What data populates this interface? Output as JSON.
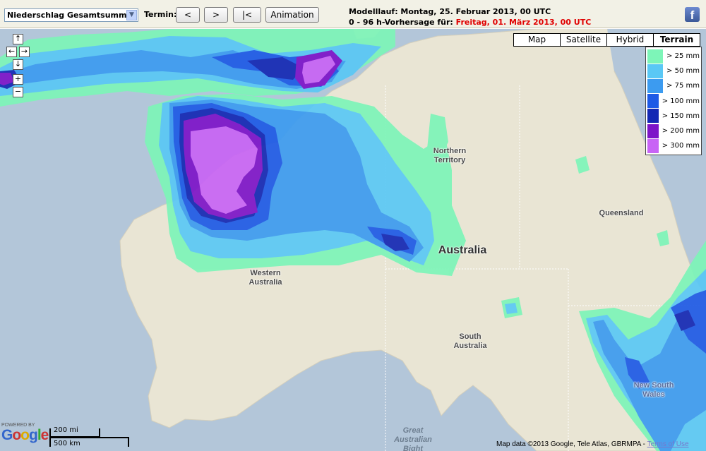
{
  "toolbar": {
    "product_select": "Niederschlag Gesamtsumme",
    "termin_label": "Termin:",
    "prev_label": "<",
    "next_label": ">",
    "first_label": "|<",
    "animation_label": "Animation",
    "run_line_label": "Modelllauf: Montag, 25. Februar 2013, 00 UTC",
    "forecast_prefix": "0 - 96 h-Vorhersage für: ",
    "forecast_date": "Freitag, 01. März 2013, 00 UTC",
    "facebook_icon": "f"
  },
  "map_controls": {
    "pan_up": "↑",
    "pan_left": "←",
    "pan_right": "→",
    "pan_down": "↓",
    "zoom_in": "+",
    "zoom_out": "−"
  },
  "map_types": [
    {
      "label": "Map",
      "active": false
    },
    {
      "label": "Satellite",
      "active": false
    },
    {
      "label": "Hybrid",
      "active": false
    },
    {
      "label": "Terrain",
      "active": true
    }
  ],
  "legend": [
    {
      "label": "> 25 mm",
      "color": "#7df5b8"
    },
    {
      "label": "> 50 mm",
      "color": "#5ac8f5"
    },
    {
      "label": "> 75 mm",
      "color": "#3c9bf0"
    },
    {
      "label": "> 100 mm",
      "color": "#1e5ae6"
    },
    {
      "label": "> 150 mm",
      "color": "#1428b4"
    },
    {
      "label": "> 200 mm",
      "color": "#7d14c8"
    },
    {
      "label": "> 300 mm",
      "color": "#c864f5"
    }
  ],
  "places": {
    "northern_territory": "Northern\nTerritory",
    "queensland": "Queensland",
    "australia": "Australia",
    "western_australia": "Western\nAustralia",
    "south_australia": "South\nAustralia",
    "new_south_wales": "New South\nWales",
    "great_australian_bight": "Great\nAustralian\nBight"
  },
  "footer": {
    "powered_by": "POWERED BY",
    "google": "Google",
    "scale_mi": "200 mi",
    "scale_km": "500 km",
    "attribution": "Map data ©2013 Google, Tele Atlas, GBRMPA - ",
    "terms": "Terms of Use"
  }
}
